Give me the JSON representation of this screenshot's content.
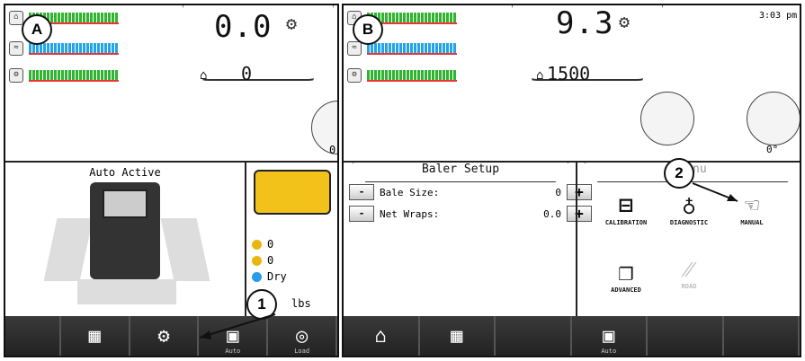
{
  "panel_a": {
    "label": "A",
    "speed": "0.0",
    "count": "0",
    "side_value": "0",
    "status_title": "Auto Active",
    "stats": [
      "0",
      "0",
      "Dry",
      "lbs"
    ],
    "buttons": [
      {
        "icon": "grid-icon",
        "sub": ""
      },
      {
        "icon": "gears-icon",
        "sub": ""
      },
      {
        "icon": "camera-icon",
        "sub": "Auto"
      },
      {
        "icon": "net-roll-icon",
        "sub": "Load"
      }
    ]
  },
  "panel_b": {
    "label": "B",
    "speed": "9.3",
    "count": "1500",
    "time": "3:03 pm",
    "angle": "0°",
    "setup_title": "Baler Setup",
    "rows": [
      {
        "label": "Bale Size:",
        "value": "0"
      },
      {
        "label": "Net Wraps:",
        "value": "0.0"
      }
    ],
    "menu_title": "Menu",
    "menu_items": [
      "CALIBRATION",
      "DIAGNOSTIC",
      "MANUAL",
      "ADVANCED",
      "ROAD"
    ],
    "buttons": [
      {
        "icon": "home-icon",
        "sub": ""
      },
      {
        "icon": "grid-icon",
        "sub": ""
      },
      {
        "icon": "",
        "sub": ""
      },
      {
        "icon": "camera-icon",
        "sub": "Auto"
      },
      {
        "icon": "",
        "sub": ""
      },
      {
        "icon": "",
        "sub": ""
      }
    ]
  },
  "callouts": [
    "1",
    "2"
  ],
  "symbols": {
    "minus": "-",
    "plus": "+"
  }
}
